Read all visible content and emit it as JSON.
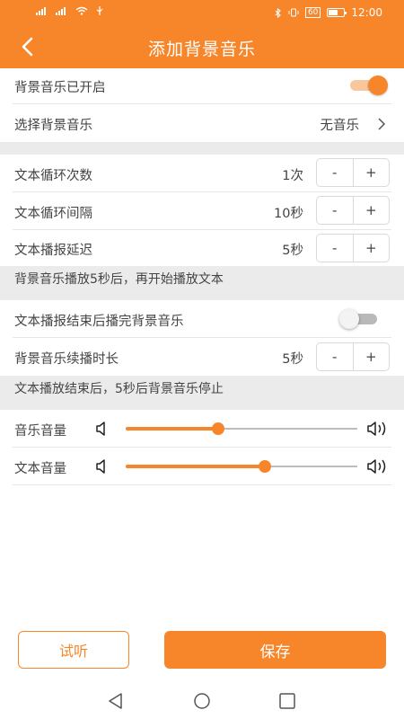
{
  "status_bar": {
    "left_sig1": "⁴⁶",
    "left_sig2": "⁴⁶",
    "time": "12:00",
    "net": "60"
  },
  "app_bar": {
    "title": "添加背景音乐"
  },
  "rows": {
    "bg_enabled": {
      "label": "背景音乐已开启",
      "toggle_on": true
    },
    "choose_music": {
      "label": "选择背景音乐",
      "value": "无音乐"
    },
    "loop_count": {
      "label": "文本循环次数",
      "value": "1次",
      "minus": "-",
      "plus": "+"
    },
    "loop_interval": {
      "label": "文本循环间隔",
      "value": "10秒",
      "minus": "-",
      "plus": "+"
    },
    "play_delay": {
      "label": "文本播报延迟",
      "value": "5秒",
      "minus": "-",
      "plus": "+"
    },
    "play_after_end": {
      "label": "文本播报结束后播完背景音乐",
      "toggle_on": false
    },
    "continue_time": {
      "label": "背景音乐续播时长",
      "value": "5秒",
      "minus": "-",
      "plus": "+"
    }
  },
  "notes": {
    "delay_note": "背景音乐播放5秒后，再开始播放文本",
    "continue_note": "文本播放结束后，5秒后背景音乐停止"
  },
  "volume": {
    "music": {
      "label": "音乐音量",
      "level": 0.4
    },
    "text": {
      "label": "文本音量",
      "level": 0.6
    }
  },
  "buttons": {
    "preview": "试听",
    "save": "保存"
  },
  "colors": {
    "accent": "#f7862a",
    "divider": "#e6e6e6",
    "section_bg": "#ebebeb"
  },
  "icons": [
    "back-arrow-icon",
    "chevron-right-icon",
    "volume-low-icon",
    "volume-high-icon",
    "nav-back-icon",
    "nav-home-icon",
    "nav-recents-icon"
  ]
}
